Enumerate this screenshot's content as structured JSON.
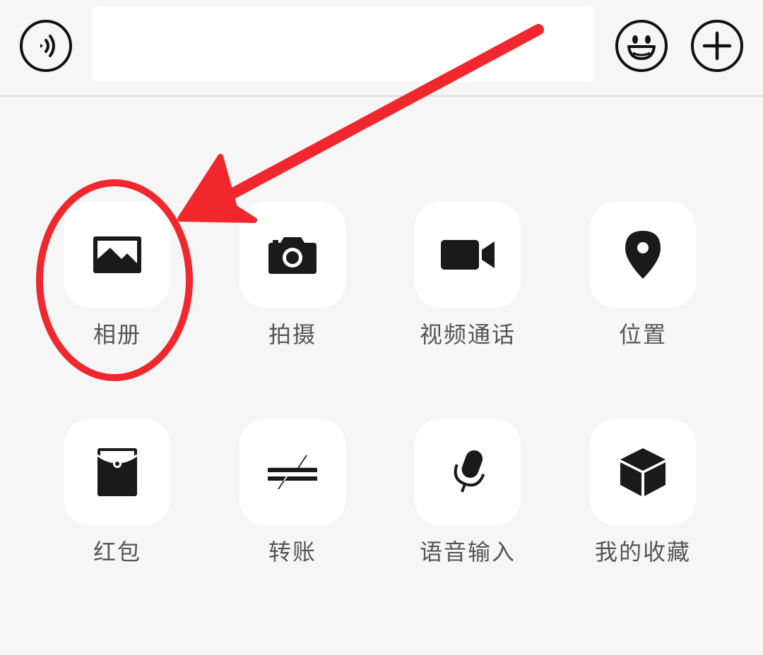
{
  "input_bar": {
    "voice_icon": "voice-wave-icon",
    "text_value": "",
    "emoji_icon": "smiley-face-icon",
    "plus_icon": "plus-icon"
  },
  "functions": [
    {
      "id": "album",
      "label": "相册",
      "icon": "image-icon"
    },
    {
      "id": "camera",
      "label": "拍摄",
      "icon": "camera-icon"
    },
    {
      "id": "video-call",
      "label": "视频通话",
      "icon": "video-camera-icon"
    },
    {
      "id": "location",
      "label": "位置",
      "icon": "location-pin-icon"
    },
    {
      "id": "red-packet",
      "label": "红包",
      "icon": "red-packet-icon"
    },
    {
      "id": "transfer",
      "label": "转账",
      "icon": "transfer-arrows-icon"
    },
    {
      "id": "voice-input",
      "label": "语音输入",
      "icon": "microphone-icon"
    },
    {
      "id": "favorites",
      "label": "我的收藏",
      "icon": "cube-icon"
    }
  ],
  "colors": {
    "annotation_red": "#f0282d",
    "icon_dark": "#1a1a1a",
    "label_gray": "#555555",
    "tile_white": "#ffffff",
    "panel_bg": "#f6f6f6"
  }
}
